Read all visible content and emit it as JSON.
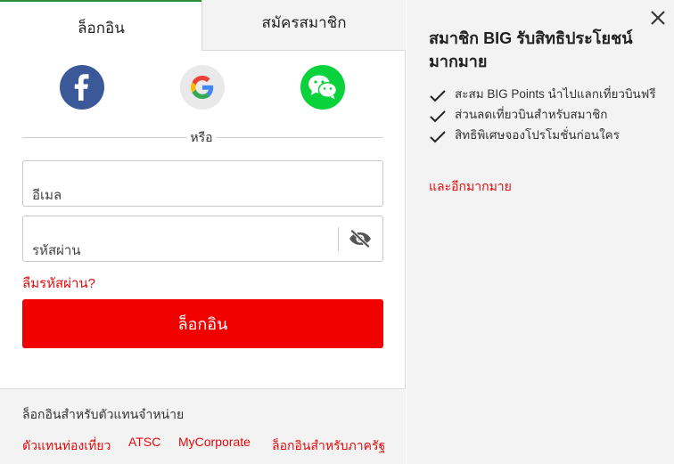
{
  "tabs": {
    "login": "ล็อกอิน",
    "signup": "สมัครสมาชิก"
  },
  "social": {
    "icons": [
      "facebook-icon",
      "google-icon",
      "wechat-icon"
    ]
  },
  "divider": {
    "or": "หรือ"
  },
  "form": {
    "email_placeholder": "อีเมล",
    "email_value": "",
    "password_placeholder": "รหัสผ่าน",
    "password_value": "",
    "forgot": "ลืมรหัสผ่าน?",
    "login_button": "ล็อกอิน"
  },
  "agent": {
    "title": "ล็อกอินสำหรับตัวแทนจำหน่าย",
    "links": [
      "ตัวแทนท่องเที่ยว",
      "ATSC",
      "MyCorporate",
      "ล็อกอินสำหรับภาครัฐ"
    ]
  },
  "benefits": {
    "title": "สมาชิก BIG รับสิทธิประโยชน์มากมาย",
    "items": [
      "สะสม BIG Points นำไปแลกเที่ยวบินฟรี",
      "ส่วนลดเที่ยวบินสำหรับสมาชิก",
      "สิทธิพิเศษจองโปรโมชั่นก่อนใคร"
    ],
    "more": "และอีกมากมาย"
  },
  "colors": {
    "accent_red": "#f20000",
    "link_red": "#e10a0a",
    "facebook": "#3b5998",
    "wechat": "#09d23a",
    "tab_active_border": "#2f8a3c"
  }
}
